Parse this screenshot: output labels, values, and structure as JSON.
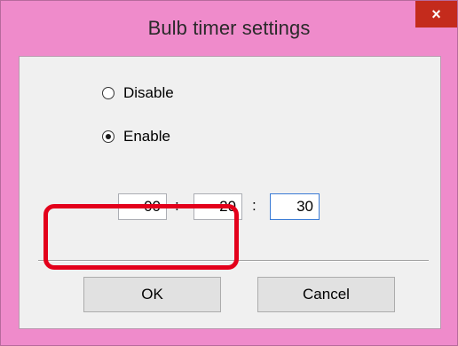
{
  "window": {
    "title": "Bulb timer settings",
    "close_glyph": "×"
  },
  "mode": {
    "options": [
      {
        "label": "Disable",
        "checked": false
      },
      {
        "label": "Enable",
        "checked": true
      }
    ]
  },
  "timer": {
    "hours": "00",
    "minutes": "20",
    "seconds": "30",
    "separator": ":"
  },
  "buttons": {
    "ok_label": "OK",
    "cancel_label": "Cancel"
  },
  "colors": {
    "frame": "#ef8bcb",
    "close": "#c42b1c",
    "highlight": "#e3001b"
  }
}
